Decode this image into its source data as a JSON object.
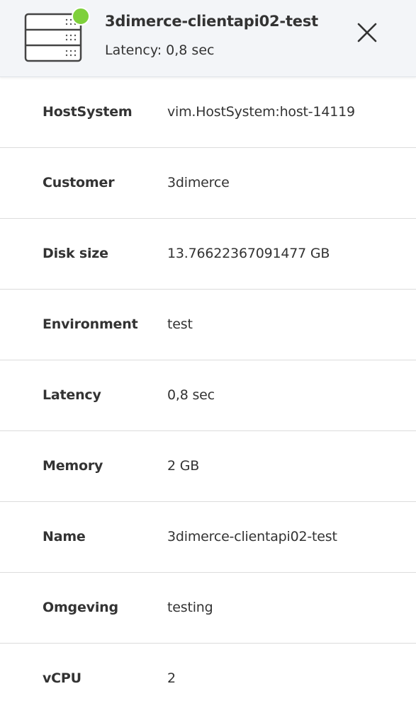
{
  "header": {
    "title": "3dimerce-clientapi02-test",
    "latency_label": "Latency:",
    "latency_value": "0,8 sec",
    "status_color": "#7ed03b",
    "icon": "server-icon",
    "close_icon": "close-icon"
  },
  "properties": [
    {
      "label": "HostSystem",
      "value": "vim.HostSystem:host-14119"
    },
    {
      "label": "Customer",
      "value": "3dimerce"
    },
    {
      "label": "Disk size",
      "value": "13.76622367091477 GB"
    },
    {
      "label": "Environment",
      "value": "test"
    },
    {
      "label": "Latency",
      "value": "0,8 sec"
    },
    {
      "label": "Memory",
      "value": "2 GB"
    },
    {
      "label": "Name",
      "value": "3dimerce-clientapi02-test"
    },
    {
      "label": "Omgeving",
      "value": "testing"
    },
    {
      "label": "vCPU",
      "value": "2"
    }
  ]
}
